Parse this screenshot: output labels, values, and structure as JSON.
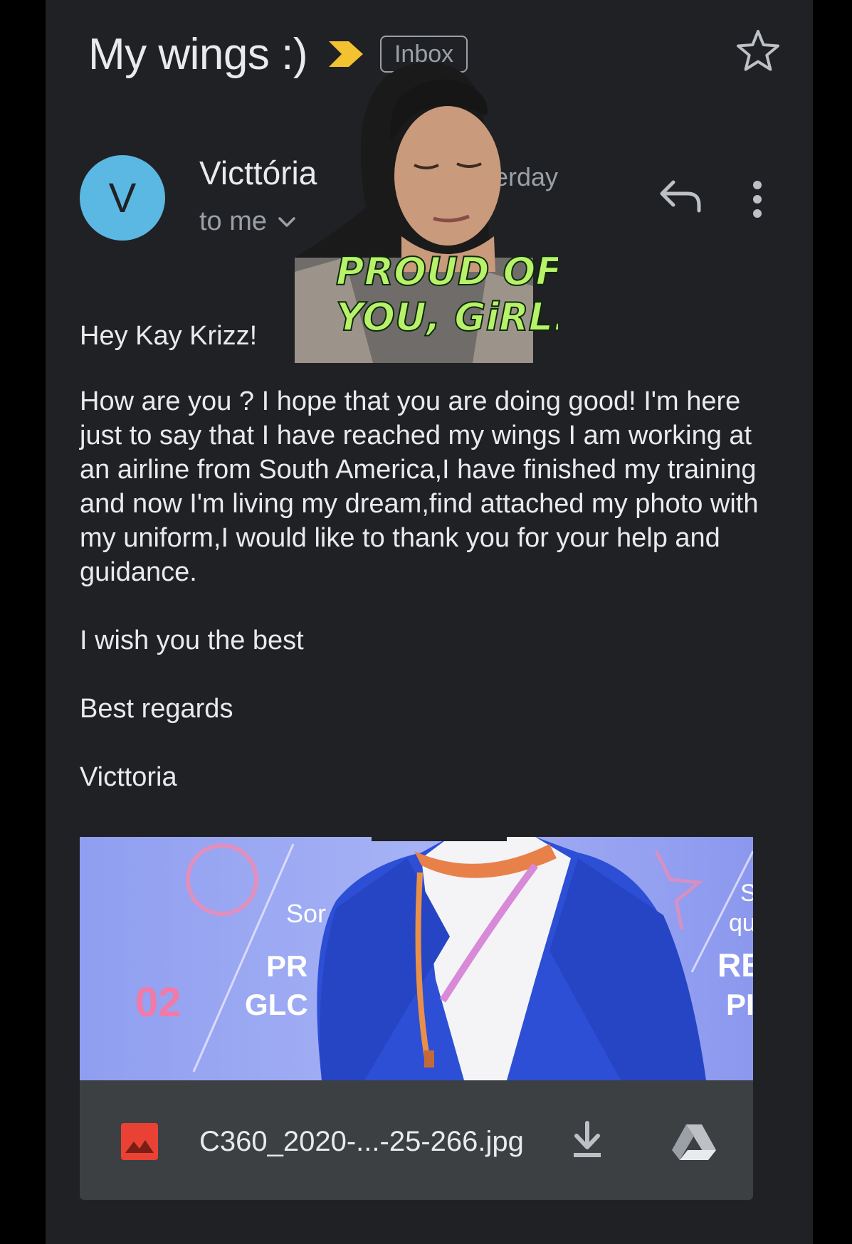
{
  "email": {
    "subject": "My wings :)",
    "label_chip": "Inbox",
    "sender_initial": "V",
    "sender_name": "Victtória",
    "recipient_line": "to me",
    "date_fragment": "erday",
    "body": {
      "greeting": "Hey Kay Krizz!",
      "paragraph": "How are you ? I hope that you are doing good! I'm here just to say that I have reached my wings I am working at an airline from South America,I have finished my training and now I'm living my dream,find attached my photo with my uniform,I would like to thank you for your help and guidance.",
      "wish": "I wish you the best",
      "regards": "Best regards",
      "signature": "Victtoria"
    },
    "attachment": {
      "file_name": "C360_2020-...-25-266.jpg",
      "preview_text": {
        "t1": "Sor",
        "t2": "PR",
        "t3": "GLC",
        "t4": "02",
        "t5": "S",
        "t6": "qu",
        "t7": "RE",
        "t8": "PI"
      }
    }
  },
  "sticker": {
    "line1": "PROUD OF",
    "line2": "YOU, GiRL."
  },
  "icons": {
    "importance": "importance-marker-icon",
    "star": "star-icon",
    "reply": "reply-icon",
    "more": "more-vert-icon",
    "chevron": "chevron-down-icon",
    "image": "image-file-icon",
    "download": "download-icon",
    "drive": "drive-icon"
  },
  "colors": {
    "background": "#202124",
    "avatar": "#5bb8e2",
    "importance": "#f2c230",
    "sticker_text": "#b7f26a",
    "attachment_bar": "#3c4043",
    "image_icon": "#e94235"
  }
}
